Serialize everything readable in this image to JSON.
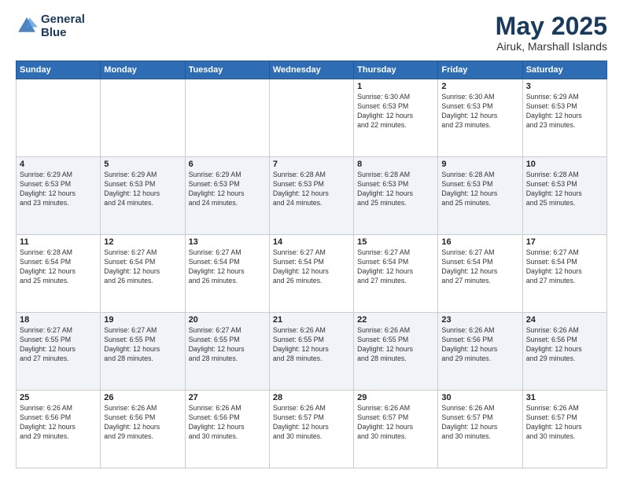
{
  "header": {
    "logo_line1": "General",
    "logo_line2": "Blue",
    "title": "May 2025",
    "subtitle": "Airuk, Marshall Islands"
  },
  "weekdays": [
    "Sunday",
    "Monday",
    "Tuesday",
    "Wednesday",
    "Thursday",
    "Friday",
    "Saturday"
  ],
  "weeks": [
    [
      {
        "day": "",
        "info": ""
      },
      {
        "day": "",
        "info": ""
      },
      {
        "day": "",
        "info": ""
      },
      {
        "day": "",
        "info": ""
      },
      {
        "day": "1",
        "info": "Sunrise: 6:30 AM\nSunset: 6:53 PM\nDaylight: 12 hours\nand 22 minutes."
      },
      {
        "day": "2",
        "info": "Sunrise: 6:30 AM\nSunset: 6:53 PM\nDaylight: 12 hours\nand 23 minutes."
      },
      {
        "day": "3",
        "info": "Sunrise: 6:29 AM\nSunset: 6:53 PM\nDaylight: 12 hours\nand 23 minutes."
      }
    ],
    [
      {
        "day": "4",
        "info": "Sunrise: 6:29 AM\nSunset: 6:53 PM\nDaylight: 12 hours\nand 23 minutes."
      },
      {
        "day": "5",
        "info": "Sunrise: 6:29 AM\nSunset: 6:53 PM\nDaylight: 12 hours\nand 24 minutes."
      },
      {
        "day": "6",
        "info": "Sunrise: 6:29 AM\nSunset: 6:53 PM\nDaylight: 12 hours\nand 24 minutes."
      },
      {
        "day": "7",
        "info": "Sunrise: 6:28 AM\nSunset: 6:53 PM\nDaylight: 12 hours\nand 24 minutes."
      },
      {
        "day": "8",
        "info": "Sunrise: 6:28 AM\nSunset: 6:53 PM\nDaylight: 12 hours\nand 25 minutes."
      },
      {
        "day": "9",
        "info": "Sunrise: 6:28 AM\nSunset: 6:53 PM\nDaylight: 12 hours\nand 25 minutes."
      },
      {
        "day": "10",
        "info": "Sunrise: 6:28 AM\nSunset: 6:53 PM\nDaylight: 12 hours\nand 25 minutes."
      }
    ],
    [
      {
        "day": "11",
        "info": "Sunrise: 6:28 AM\nSunset: 6:54 PM\nDaylight: 12 hours\nand 25 minutes."
      },
      {
        "day": "12",
        "info": "Sunrise: 6:27 AM\nSunset: 6:54 PM\nDaylight: 12 hours\nand 26 minutes."
      },
      {
        "day": "13",
        "info": "Sunrise: 6:27 AM\nSunset: 6:54 PM\nDaylight: 12 hours\nand 26 minutes."
      },
      {
        "day": "14",
        "info": "Sunrise: 6:27 AM\nSunset: 6:54 PM\nDaylight: 12 hours\nand 26 minutes."
      },
      {
        "day": "15",
        "info": "Sunrise: 6:27 AM\nSunset: 6:54 PM\nDaylight: 12 hours\nand 27 minutes."
      },
      {
        "day": "16",
        "info": "Sunrise: 6:27 AM\nSunset: 6:54 PM\nDaylight: 12 hours\nand 27 minutes."
      },
      {
        "day": "17",
        "info": "Sunrise: 6:27 AM\nSunset: 6:54 PM\nDaylight: 12 hours\nand 27 minutes."
      }
    ],
    [
      {
        "day": "18",
        "info": "Sunrise: 6:27 AM\nSunset: 6:55 PM\nDaylight: 12 hours\nand 27 minutes."
      },
      {
        "day": "19",
        "info": "Sunrise: 6:27 AM\nSunset: 6:55 PM\nDaylight: 12 hours\nand 28 minutes."
      },
      {
        "day": "20",
        "info": "Sunrise: 6:27 AM\nSunset: 6:55 PM\nDaylight: 12 hours\nand 28 minutes."
      },
      {
        "day": "21",
        "info": "Sunrise: 6:26 AM\nSunset: 6:55 PM\nDaylight: 12 hours\nand 28 minutes."
      },
      {
        "day": "22",
        "info": "Sunrise: 6:26 AM\nSunset: 6:55 PM\nDaylight: 12 hours\nand 28 minutes."
      },
      {
        "day": "23",
        "info": "Sunrise: 6:26 AM\nSunset: 6:56 PM\nDaylight: 12 hours\nand 29 minutes."
      },
      {
        "day": "24",
        "info": "Sunrise: 6:26 AM\nSunset: 6:56 PM\nDaylight: 12 hours\nand 29 minutes."
      }
    ],
    [
      {
        "day": "25",
        "info": "Sunrise: 6:26 AM\nSunset: 6:56 PM\nDaylight: 12 hours\nand 29 minutes."
      },
      {
        "day": "26",
        "info": "Sunrise: 6:26 AM\nSunset: 6:56 PM\nDaylight: 12 hours\nand 29 minutes."
      },
      {
        "day": "27",
        "info": "Sunrise: 6:26 AM\nSunset: 6:56 PM\nDaylight: 12 hours\nand 30 minutes."
      },
      {
        "day": "28",
        "info": "Sunrise: 6:26 AM\nSunset: 6:57 PM\nDaylight: 12 hours\nand 30 minutes."
      },
      {
        "day": "29",
        "info": "Sunrise: 6:26 AM\nSunset: 6:57 PM\nDaylight: 12 hours\nand 30 minutes."
      },
      {
        "day": "30",
        "info": "Sunrise: 6:26 AM\nSunset: 6:57 PM\nDaylight: 12 hours\nand 30 minutes."
      },
      {
        "day": "31",
        "info": "Sunrise: 6:26 AM\nSunset: 6:57 PM\nDaylight: 12 hours\nand 30 minutes."
      }
    ]
  ]
}
